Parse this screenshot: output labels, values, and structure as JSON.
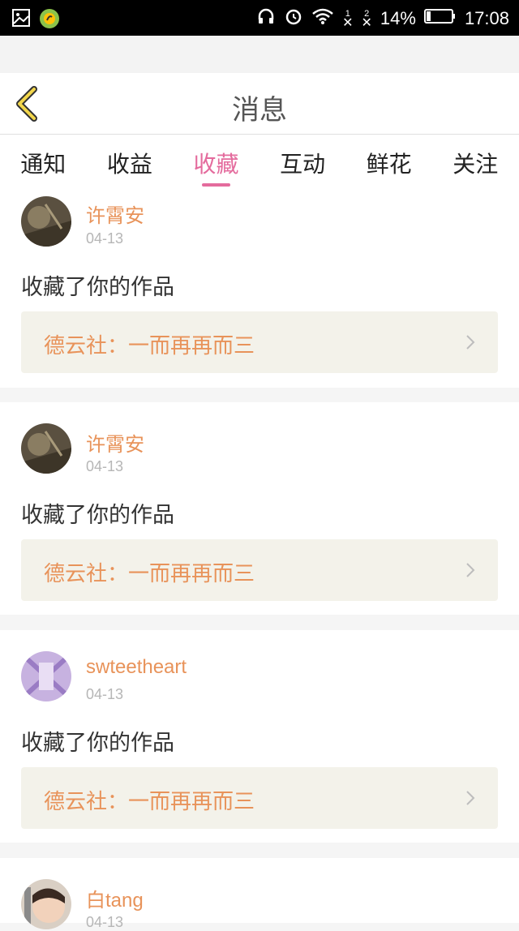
{
  "status_bar": {
    "battery": "14%",
    "time": "17:08",
    "sim1": "1",
    "sim2": "2"
  },
  "header": {
    "title": "消息",
    "back_icon": "chevron-left-icon"
  },
  "tabs": [
    {
      "label": "通知"
    },
    {
      "label": "收益"
    },
    {
      "label": "收藏",
      "active": true
    },
    {
      "label": "互动"
    },
    {
      "label": "鲜花"
    },
    {
      "label": "关注"
    }
  ],
  "accent": "#e46b9d",
  "name_color": "#e8935a",
  "items": [
    {
      "name": "许霄安",
      "date": "04-13",
      "message": "收藏了你的作品",
      "work": "德云社：一而再再而三"
    },
    {
      "name": "许霄安",
      "date": "04-13",
      "message": "收藏了你的作品",
      "work": "德云社：一而再再而三"
    },
    {
      "name": "swteetheart",
      "date": "04-13",
      "message": "收藏了你的作品",
      "work": "德云社：一而再再而三"
    },
    {
      "name": "白tang",
      "date": "04-13"
    }
  ]
}
